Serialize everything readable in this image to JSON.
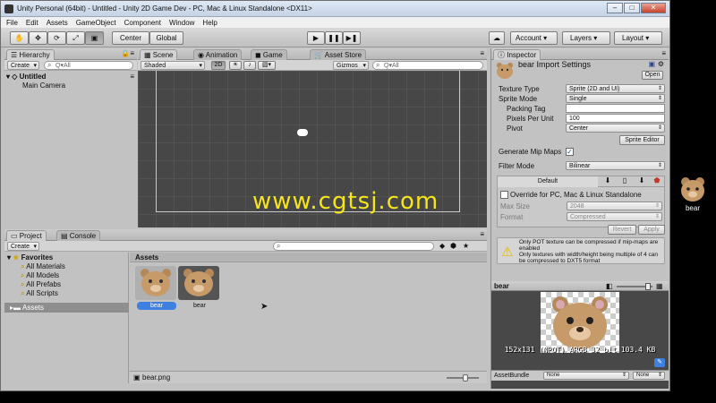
{
  "window": {
    "title": "Unity Personal (64bit) - Untitled - Unity 2D Game Dev - PC, Mac & Linux Standalone <DX11>",
    "min": "–",
    "max": "□",
    "close": "✕"
  },
  "menu": [
    "File",
    "Edit",
    "Assets",
    "GameObject",
    "Component",
    "Window",
    "Help"
  ],
  "toolbar": {
    "pivot": "Center",
    "space": "Global",
    "account": "Account",
    "layers": "Layers",
    "layout": "Layout",
    "play": "▶",
    "pause": "❚❚",
    "step": "▶❚"
  },
  "hierarchy": {
    "tab": "Hierarchy",
    "create": "Create",
    "search_placeholder": "Q▾All",
    "scene": "Untitled",
    "items": [
      "Main Camera"
    ]
  },
  "scene": {
    "tabs": [
      "Scene",
      "Animation",
      "Game",
      "Asset Store"
    ],
    "shaded": "Shaded",
    "mode2d": "2D",
    "gizmos": "Gizmos",
    "search": "Q▾All",
    "watermark": "www.cgtsj.com"
  },
  "project": {
    "tabs": [
      "Project",
      "Console"
    ],
    "create": "Create",
    "favorites_title": "Favorites",
    "favorites": [
      "All Materials",
      "All Models",
      "All Prefabs",
      "All Scripts"
    ],
    "assets_root": "Assets",
    "breadcrumb": "Assets",
    "items": [
      {
        "label": "bear",
        "selected": true
      },
      {
        "label": "bear",
        "selected": false
      }
    ],
    "footer_file": "bear.png"
  },
  "inspector": {
    "tab": "Inspector",
    "title": "bear Import Settings",
    "open": "Open",
    "rows": [
      {
        "label": "Texture Type",
        "value": "Sprite (2D and UI)",
        "kind": "dropdown"
      },
      {
        "label": "Sprite Mode",
        "value": "Single",
        "kind": "dropdown"
      },
      {
        "label": "Packing Tag",
        "value": "",
        "kind": "text"
      },
      {
        "label": "Pixels Per Unit",
        "value": "100",
        "kind": "text"
      },
      {
        "label": "Pivot",
        "value": "Center",
        "kind": "dropdown"
      }
    ],
    "sprite_editor": "Sprite Editor",
    "mipmaps_label": "Generate Mip Maps",
    "filter_label": "Filter Mode",
    "filter_value": "Bilinear",
    "platform_default": "Default",
    "override_label": "Override for PC, Mac & Linux Standalone",
    "max_size_label": "Max Size",
    "max_size_value": "2048",
    "format_label": "Format",
    "format_value": "Compressed",
    "revert": "Revert",
    "apply": "Apply",
    "warnings": [
      "Only POT texture can be compressed if mip-maps are enabled",
      "Only textures with width/height being multiple of 4 can be compressed to DXT5 format"
    ],
    "preview_name": "bear",
    "preview_info": "152x131 (NPOT) ARGB 32 bit 103.4 KB",
    "assetbundle_label": "AssetBundle",
    "assetbundle_value": "None",
    "assetbundle_variant": "None"
  },
  "desktop": {
    "icon_label": "bear"
  },
  "colors": {
    "scene_bg": "#474747",
    "selection": "#3d80df",
    "watermark": "#f5e51a",
    "bear": "#c79a6a"
  }
}
